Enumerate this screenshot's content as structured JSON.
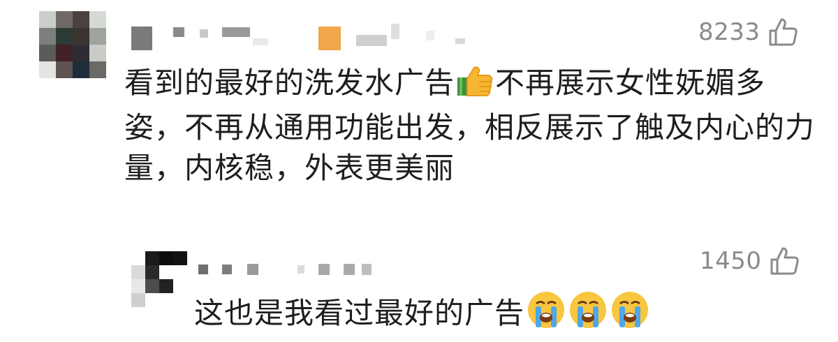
{
  "comments": [
    {
      "likes": "8233",
      "text_before": "看到的最好的洗发水广告",
      "emoji_inline": "thumbs-up",
      "text_after": "不再展示女性妩媚多姿，不再从通用功能出发，相反展示了触及内心的力量，内核稳，外表更美丽",
      "like_icon": "thumbs-up-outline-icon"
    },
    {
      "likes": "1450",
      "text": "这也是我看过最好的广告",
      "emoji_trailing": [
        "crying-face",
        "crying-face",
        "crying-face"
      ],
      "like_icon": "thumbs-up-outline-icon"
    }
  ],
  "colors": {
    "text": "#1e1e1e",
    "like_count": "#8a8a8a",
    "background": "#ffffff",
    "accent_orange": "#f0a64a"
  }
}
